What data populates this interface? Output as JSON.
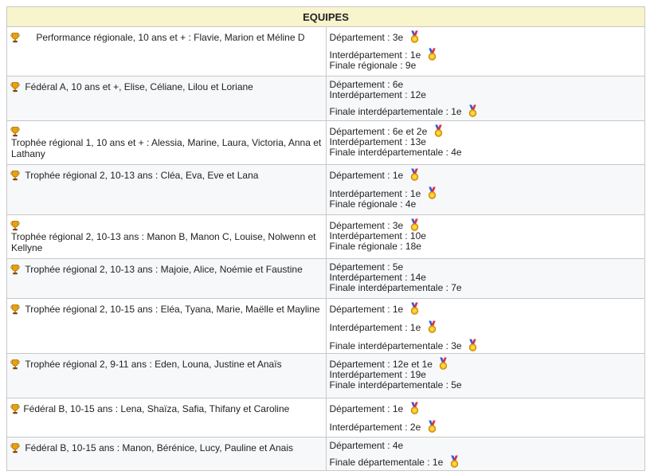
{
  "header": {
    "title": "EQUIPES"
  },
  "rows": [
    {
      "team": "Performance régionale, 10 ans et + : Flavie, Marion et Méline D",
      "indent": 16,
      "results": [
        {
          "text": "Département : 3e",
          "medal": true
        },
        {
          "text": "Interdépartement : 1e",
          "medal": true
        },
        {
          "text": "Finale régionale : 9e",
          "medal": false
        }
      ]
    },
    {
      "team": "Fédéral A,  10 ans et +, Elise, Céliane, Lilou et Loriane",
      "indent": 0,
      "results": [
        {
          "text": "Département : 6e",
          "medal": false
        },
        {
          "text": "Interdépartement : 12e",
          "medal": false
        },
        {
          "text": "Finale interdépartementale : 1e",
          "medal": true
        }
      ]
    },
    {
      "team": "Trophée régional 1, 10 ans et + : Alessia, Marine, Laura, Victoria, Anna et Lathany",
      "indent": 0,
      "results": [
        {
          "text": "Département : 6e et 2e",
          "medal": true
        },
        {
          "text": "Interdépartement : 13e",
          "medal": false
        },
        {
          "text": "Finale interdépartementale : 4e",
          "medal": false
        }
      ]
    },
    {
      "team": "Trophée régional 2, 10-13 ans : Cléa, Eva, Eve et Lana",
      "indent": 0,
      "results": [
        {
          "text": "Département : 1e",
          "medal": true
        },
        {
          "text": "Interdépartement : 1e",
          "medal": true
        },
        {
          "text": "Finale régionale : 4e",
          "medal": false
        }
      ]
    },
    {
      "team": "Trophée régional 2, 10-13 ans : Manon B, Manon C, Louise, Nolwenn et Kellyne",
      "indent": 0,
      "results": [
        {
          "text": "Département : 3e",
          "medal": true
        },
        {
          "text": "Interdépartement : 10e",
          "medal": false
        },
        {
          "text": "Finale régionale : 18e",
          "medal": false
        }
      ]
    },
    {
      "team": "Trophée régional 2, 10-13 ans : Majoie, Alice, Noémie et Faustine",
      "indent": 0,
      "results": [
        {
          "text": "Département : 5e",
          "medal": false
        },
        {
          "text": "Interdépartement : 14e",
          "medal": false
        },
        {
          "text": "Finale interdépartementale : 7e",
          "medal": false
        }
      ]
    },
    {
      "team": "Trophée régional 2, 10-15 ans : Eléa, Tyana, Marie, Maëlle et Mayline",
      "indent": 0,
      "results": [
        {
          "text": "Département : 1e",
          "medal": true
        },
        {
          "text": "Interdépartement : 1e",
          "medal": true
        },
        {
          "text": "Finale interdépartementale : 3e",
          "medal": true
        }
      ]
    },
    {
      "team": "Trophée régional 2, 9-11 ans : Eden, Louna, Justine et Anaïs",
      "indent": 0,
      "results": [
        {
          "text": "Département : 12e et 1e",
          "medal": true
        },
        {
          "text": "Interdépartement : 19e",
          "medal": false
        },
        {
          "text": "Finale interdépartementale : 5e",
          "medal": false
        }
      ]
    },
    {
      "team": "Fédéral B, 10-15 ans : Lena, Shaïza, Safia, Thifany et Caroline",
      "indent": 0,
      "results": [
        {
          "text": "Département : 1e",
          "medal": true
        },
        {
          "text": "Interdépartement : 2e",
          "medal": true
        }
      ]
    },
    {
      "team": "Fédéral B, 10-15 ans : Manon, Bérénice, Lucy, Pauline et Anais",
      "indent": 0,
      "results": [
        {
          "text": "Département : 4e",
          "medal": false
        },
        {
          "text": "Finale départementale : 1e",
          "medal": true
        }
      ]
    }
  ]
}
